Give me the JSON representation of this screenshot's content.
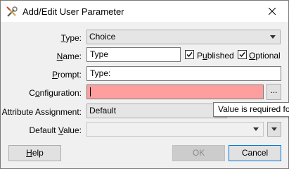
{
  "window": {
    "title": "Add/Edit User Parameter",
    "close_icon": "close-icon",
    "app_icon": "fme-tools-icon"
  },
  "form": {
    "type": {
      "label_pre": "",
      "label_u": "T",
      "label_post": "ype:",
      "value": "Choice"
    },
    "name": {
      "label_u": "N",
      "label_post": "ame:",
      "value": "Type"
    },
    "published": {
      "label_pre": "P",
      "label_u": "u",
      "label_post": "blished",
      "checked": true
    },
    "optional": {
      "label_u": "O",
      "label_post": "ptional",
      "checked": true
    },
    "prompt": {
      "label_u": "P",
      "label_post": "rompt:",
      "value": "Type:"
    },
    "configuration": {
      "label_pre": "C",
      "label_u": "o",
      "label_post": "nfiguration:",
      "value": "",
      "error_color": "#ff9e9e",
      "ellipsis_label": "..."
    },
    "attribute_assignment": {
      "label": "Attribute Assignment:",
      "value": "Default"
    },
    "default_value": {
      "label_pre": "Default ",
      "label_u": "V",
      "label_post": "alue:",
      "value": ""
    }
  },
  "tooltip": {
    "text": "Value is required fo"
  },
  "buttons": {
    "help": {
      "label_u": "H",
      "label_post": "elp"
    },
    "ok": {
      "label": "OK"
    },
    "cancel": {
      "label": "Cancel"
    }
  }
}
